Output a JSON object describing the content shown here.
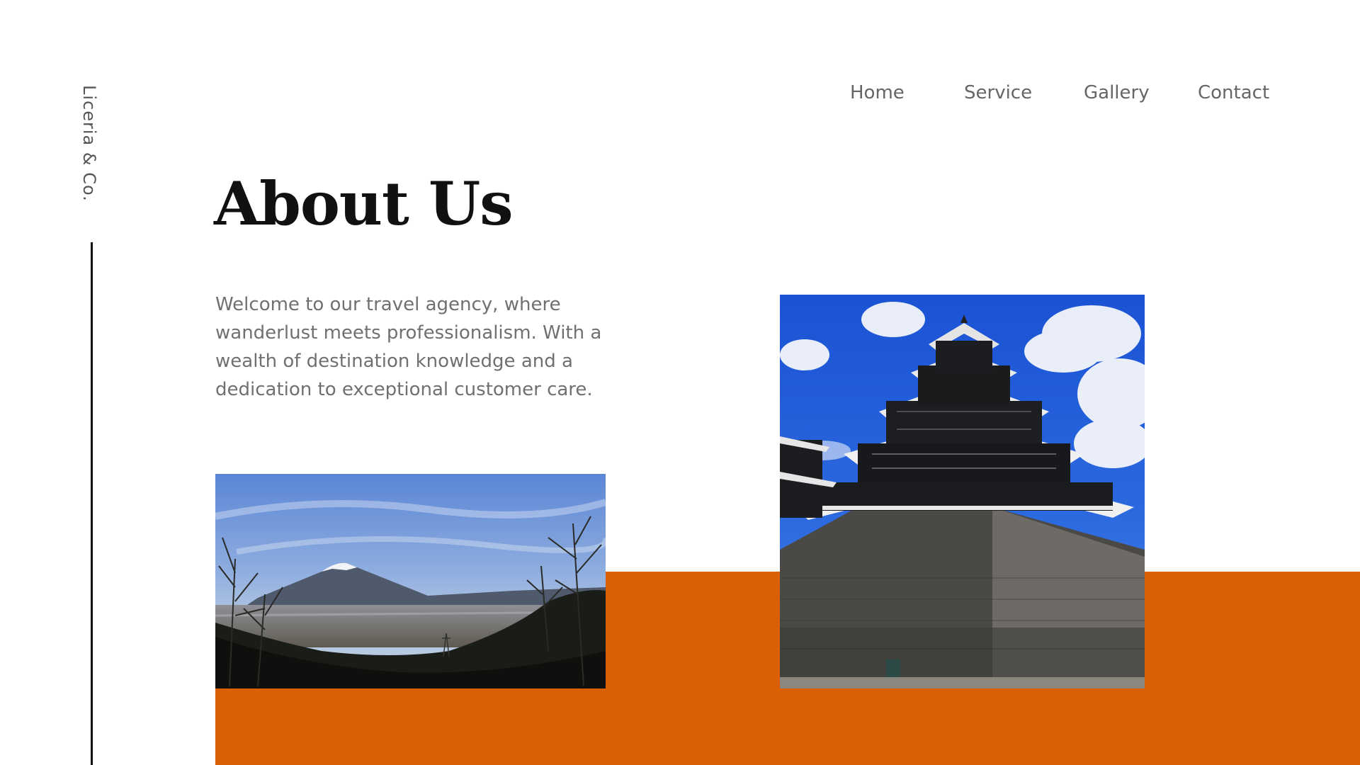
{
  "brand": {
    "name": "Liceria & Co."
  },
  "nav": {
    "items": [
      {
        "label": "Home"
      },
      {
        "label": "Service"
      },
      {
        "label": "Gallery"
      },
      {
        "label": "Contact"
      }
    ]
  },
  "hero": {
    "title": "About Us",
    "intro": "Welcome to our travel agency, where wanderlust meets professionalism. With a wealth of destination knowledge and a dedication to exceptional customer care."
  },
  "colors": {
    "accent": "#DA5F05",
    "text_muted": "#707070",
    "heading": "#111111"
  },
  "images": [
    {
      "subject": "mountain-landscape-photo"
    },
    {
      "subject": "japanese-castle-photo"
    }
  ]
}
